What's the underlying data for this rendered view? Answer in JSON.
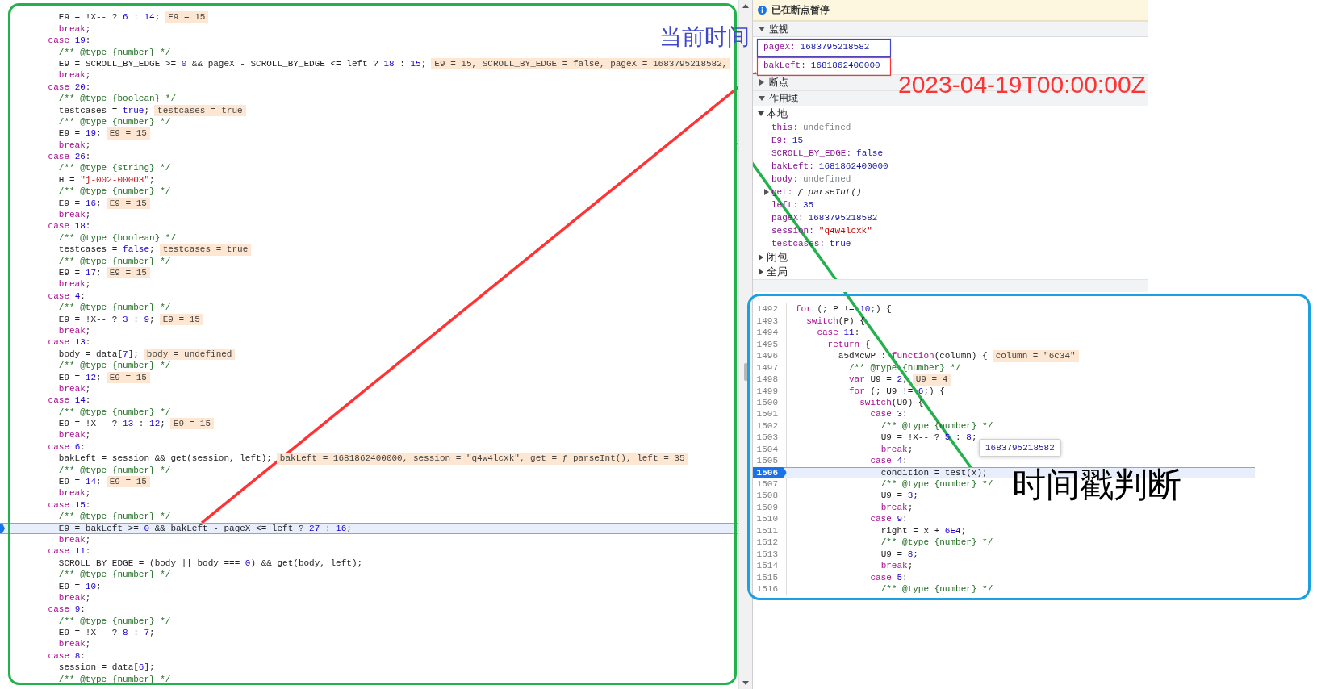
{
  "left_code": {
    "lines": [
      {
        "text": "        E9 = !X-- ? 6 : 14;",
        "value": "E9 = 15",
        "current": false
      },
      {
        "text": "        break;",
        "current": false
      },
      {
        "text": "      case 19:",
        "current": false
      },
      {
        "text": "        /** @type {number} */",
        "current": false
      },
      {
        "text": "        E9 = SCROLL_BY_EDGE >= 0 && pageX - SCROLL_BY_EDGE <= left ? 18 : 15;",
        "value": "E9 = 15, SCROLL_BY_EDGE = false, pageX = 1683795218582,",
        "current": false
      },
      {
        "text": "        break;",
        "current": false
      },
      {
        "text": "      case 20:",
        "current": false
      },
      {
        "text": "        /** @type {boolean} */",
        "current": false
      },
      {
        "text": "        testcases = true;",
        "value": "testcases = true",
        "current": false
      },
      {
        "text": "        /** @type {number} */",
        "current": false
      },
      {
        "text": "        E9 = 19;",
        "value": "E9 = 15",
        "current": false
      },
      {
        "text": "        break;",
        "current": false
      },
      {
        "text": "      case 26:",
        "current": false
      },
      {
        "text": "        /** @type {string} */",
        "current": false
      },
      {
        "text": "        H = \"j-002-00003\";",
        "current": false
      },
      {
        "text": "        /** @type {number} */",
        "current": false
      },
      {
        "text": "        E9 = 16;",
        "value": "E9 = 15",
        "current": false
      },
      {
        "text": "        break;",
        "current": false
      },
      {
        "text": "      case 18:",
        "current": false
      },
      {
        "text": "        /** @type {boolean} */",
        "current": false
      },
      {
        "text": "        testcases = false;",
        "value": "testcases = true",
        "current": false
      },
      {
        "text": "        /** @type {number} */",
        "current": false
      },
      {
        "text": "        E9 = 17;",
        "value": "E9 = 15",
        "current": false
      },
      {
        "text": "        break;",
        "current": false
      },
      {
        "text": "      case 4:",
        "current": false
      },
      {
        "text": "        /** @type {number} */",
        "current": false
      },
      {
        "text": "        E9 = !X-- ? 3 : 9;",
        "value": "E9 = 15",
        "current": false
      },
      {
        "text": "        break;",
        "current": false
      },
      {
        "text": "      case 13:",
        "current": false
      },
      {
        "text": "        body = data[7];",
        "value": "body = undefined",
        "current": false
      },
      {
        "text": "        /** @type {number} */",
        "current": false
      },
      {
        "text": "        E9 = 12;",
        "value": "E9 = 15",
        "current": false
      },
      {
        "text": "        break;",
        "current": false
      },
      {
        "text": "      case 14:",
        "current": false
      },
      {
        "text": "        /** @type {number} */",
        "current": false
      },
      {
        "text": "        E9 = !X-- ? 13 : 12;",
        "value": "E9 = 15",
        "current": false
      },
      {
        "text": "        break;",
        "current": false
      },
      {
        "text": "      case 6:",
        "current": false
      },
      {
        "text": "        bakLeft = session && get(session, left);",
        "value": "bakLeft = 1681862400000, session = \"q4w4lcxk\", get = ƒ parseInt(), left = 35",
        "current": false
      },
      {
        "text": "        /** @type {number} */",
        "current": false
      },
      {
        "text": "        E9 = 14;",
        "value": "E9 = 15",
        "current": false
      },
      {
        "text": "        break;",
        "current": false
      },
      {
        "text": "      case 15:",
        "current": false
      },
      {
        "text": "        /** @type {number} */",
        "current": false
      },
      {
        "text": "        E9 = bakLeft >= 0 && bakLeft - pageX <= left ? 27 : 16;",
        "current": true
      },
      {
        "text": "        break;",
        "current": false
      },
      {
        "text": "      case 11:",
        "current": false
      },
      {
        "text": "        SCROLL_BY_EDGE = (body || body === 0) && get(body, left);",
        "current": false
      },
      {
        "text": "        /** @type {number} */",
        "current": false
      },
      {
        "text": "        E9 = 10;",
        "current": false
      },
      {
        "text": "        break;",
        "current": false
      },
      {
        "text": "      case 9:",
        "current": false
      },
      {
        "text": "        /** @type {number} */",
        "current": false
      },
      {
        "text": "        E9 = !X-- ? 8 : 7;",
        "current": false
      },
      {
        "text": "        break;",
        "current": false
      },
      {
        "text": "      case 8:",
        "current": false
      },
      {
        "text": "        session = data[6];",
        "current": false
      },
      {
        "text": "        /** @type {number} */",
        "current": false
      }
    ]
  },
  "debugger": {
    "paused_banner": "已在断点暂停",
    "watch": {
      "title": "监视",
      "expanded": true,
      "items": [
        {
          "name": "pageX:",
          "value": "1683795218582"
        },
        {
          "name": "bakLeft:",
          "value": "1681862400000"
        }
      ]
    },
    "breakpoints": {
      "title": "断点",
      "expanded": false
    },
    "scope": {
      "title": "作用域",
      "expanded": true,
      "groups": [
        {
          "title": "本地",
          "expanded": true,
          "variables": [
            {
              "name": "this:",
              "value": "undefined",
              "kind": "undefined",
              "has_children": false
            },
            {
              "name": "E9:",
              "value": "15",
              "kind": "number",
              "has_children": false
            },
            {
              "name": "SCROLL_BY_EDGE:",
              "value": "false",
              "kind": "boolean",
              "has_children": false
            },
            {
              "name": "bakLeft:",
              "value": "1681862400000",
              "kind": "number",
              "has_children": false
            },
            {
              "name": "body:",
              "value": "undefined",
              "kind": "undefined",
              "has_children": false
            },
            {
              "name": "get:",
              "value": "ƒ parseInt()",
              "kind": "function",
              "has_children": true
            },
            {
              "name": "left:",
              "value": "35",
              "kind": "number",
              "has_children": false
            },
            {
              "name": "pageX:",
              "value": "1683795218582",
              "kind": "number",
              "has_children": false
            },
            {
              "name": "session:",
              "value": "\"q4w4lcxk\"",
              "kind": "string",
              "has_children": false
            },
            {
              "name": "testcases:",
              "value": "true",
              "kind": "boolean",
              "has_children": false
            }
          ]
        },
        {
          "title": "闭包",
          "expanded": false
        },
        {
          "title": "全局",
          "expanded": false
        }
      ]
    }
  },
  "right_code": {
    "tooltip": "1683795218582",
    "lines": [
      {
        "number": "1492",
        "text": "for (; P != 10;) {",
        "current": false
      },
      {
        "number": "1493",
        "text": "  switch(P) {",
        "current": false
      },
      {
        "number": "1494",
        "text": "    case 11:",
        "current": false
      },
      {
        "number": "1495",
        "text": "      return {",
        "current": false
      },
      {
        "number": "1496",
        "text": "        a5dMcwP : function(column) {",
        "value": "column = \"6c34\"",
        "current": false
      },
      {
        "number": "1497",
        "text": "          /** @type {number} */",
        "current": false
      },
      {
        "number": "1498",
        "text": "          var U9 = 2;",
        "value": "U9 = 4",
        "current": false
      },
      {
        "number": "1499",
        "text": "          for (; U9 != 6;) {",
        "current": false
      },
      {
        "number": "1500",
        "text": "            switch(U9) {",
        "current": false
      },
      {
        "number": "1501",
        "text": "              case 3:",
        "current": false
      },
      {
        "number": "1502",
        "text": "                /** @type {number} */",
        "current": false
      },
      {
        "number": "1503",
        "text": "                U9 = !X-- ? 5 : 8;",
        "current": false
      },
      {
        "number": "1504",
        "text": "                break;",
        "current": false
      },
      {
        "number": "1505",
        "text": "              case 4:",
        "current": false
      },
      {
        "number": "1506",
        "text": "                condition = test(x);",
        "current": true
      },
      {
        "number": "1507",
        "text": "                /** @type {number} */",
        "current": false
      },
      {
        "number": "1508",
        "text": "                U9 = 3;",
        "current": false
      },
      {
        "number": "1509",
        "text": "                break;",
        "current": false
      },
      {
        "number": "1510",
        "text": "              case 9:",
        "current": false
      },
      {
        "number": "1511",
        "text": "                right = x + 6E4;",
        "current": false
      },
      {
        "number": "1512",
        "text": "                /** @type {number} */",
        "current": false
      },
      {
        "number": "1513",
        "text": "                U9 = 8;",
        "current": false
      },
      {
        "number": "1514",
        "text": "                break;",
        "current": false
      },
      {
        "number": "1515",
        "text": "              case 5:",
        "current": false
      },
      {
        "number": "1516",
        "text": "                /** @type {number} */",
        "current": false
      }
    ]
  },
  "annotations": [
    {
      "text": "当前时间",
      "color": "#3f48cc"
    },
    {
      "text": "2023-04-19T00:00:00Z",
      "color": "#ff3333"
    },
    {
      "text": "时间戳判断",
      "color": "#000000"
    }
  ]
}
